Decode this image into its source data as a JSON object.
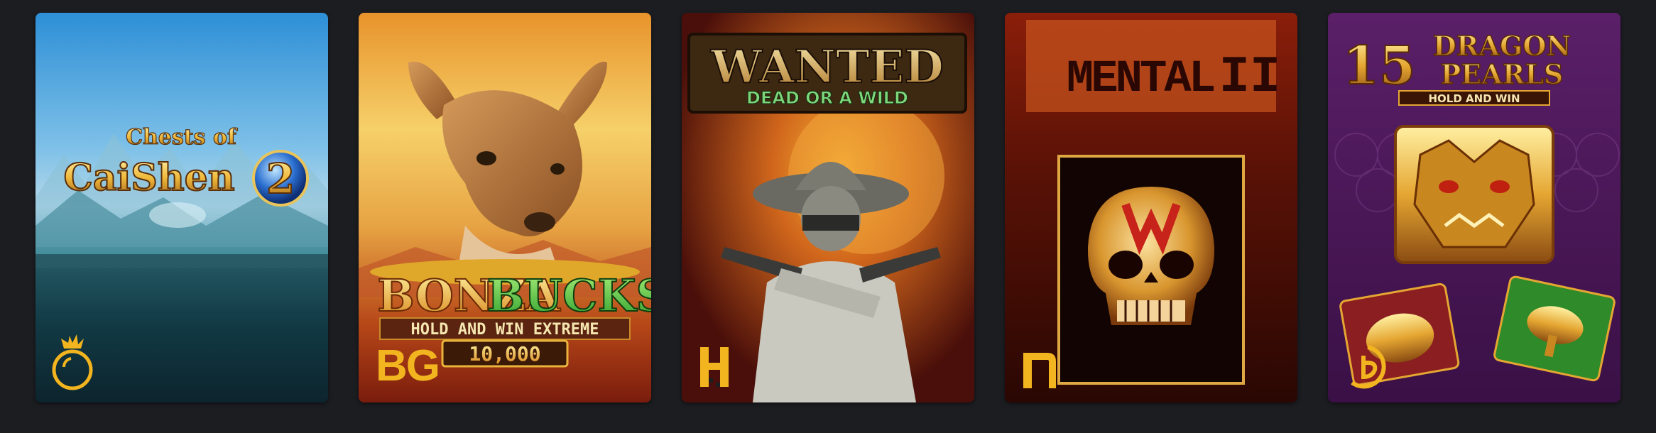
{
  "games": [
    {
      "title_line1": "Chests of",
      "title_line2": "CaiShen",
      "title_num": "2",
      "provider_icon": "pragmatic-play-icon"
    },
    {
      "title_line1": "BONZA",
      "title_line2": "BUCKS",
      "subtitle": "HOLD AND WIN EXTREME",
      "badge": "10,000",
      "provider_logo": "BG",
      "provider_icon": "bg-logo"
    },
    {
      "title_line1": "WANTED",
      "title_line2": "DEAD OR A WILD",
      "provider_icon": "hacksaw-icon"
    },
    {
      "title_line1": "MENTAL",
      "title_num": "II",
      "provider_icon": "nolimit-icon"
    },
    {
      "title_num": "15",
      "title_line1": "DRAGON",
      "title_line2": "PEARLS",
      "subtitle": "HOLD AND WIN",
      "provider_icon": "booongo-icon"
    }
  ],
  "colors": {
    "page_bg": "#1c1d21",
    "provider_gold": "#f3b51f"
  }
}
